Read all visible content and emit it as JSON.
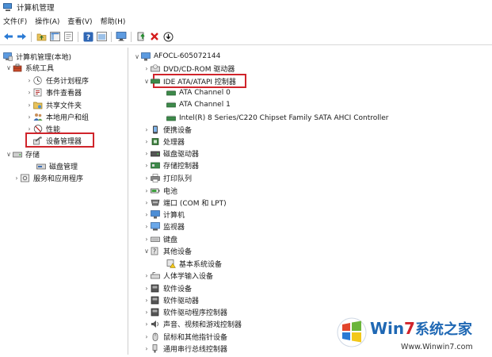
{
  "window": {
    "title": "计算机管理"
  },
  "menu": [
    "文件(F)",
    "操作(A)",
    "查看(V)",
    "帮助(H)"
  ],
  "toolbar_icons": [
    "back-arrow-icon",
    "forward-arrow-icon",
    "up-folder-icon",
    "console-tree-icon",
    "properties-icon",
    "help-icon",
    "pane-icon",
    "monitor-icon",
    "update-driver-icon",
    "uninstall-icon",
    "scan-hardware-icon"
  ],
  "left_tree": {
    "root": "计算机管理(本地)",
    "system_tools": "系统工具",
    "task_scheduler": "任务计划程序",
    "event_viewer": "事件查看器",
    "shared_folders": "共享文件夹",
    "local_users": "本地用户和组",
    "performance": "性能",
    "device_manager": "设备管理器",
    "storage": "存储",
    "disk_management": "磁盘管理",
    "services": "服务和应用程序"
  },
  "device_tree": {
    "computer": "AFOCL-605072144",
    "dvd": "DVD/CD-ROM 驱动器",
    "ide": "IDE ATA/ATAPI 控制器",
    "ch0": "ATA Channel 0",
    "ch1": "ATA Channel 1",
    "sata": "Intel(R) 8 Series/C220 Chipset Family SATA AHCI Controller",
    "portable": "便携设备",
    "cpu": "处理器",
    "disk": "磁盘驱动器",
    "storage_ctrl": "存储控制器",
    "print_queue": "打印队列",
    "battery": "电池",
    "ports": "端口 (COM 和 LPT)",
    "computer_node": "计算机",
    "monitor": "监视器",
    "keyboard": "键盘",
    "other": "其他设备",
    "base_system": "基本系统设备",
    "hid": "人体学输入设备",
    "software_dev": "软件设备",
    "software_drv": "软件驱动器",
    "software_bus": "软件驱动程序控制器",
    "sound": "声音、视频和游戏控制器",
    "mouse": "鼠标和其他指针设备",
    "usb": "通用串行总线控制器"
  },
  "watermark": {
    "brand_a": "Win",
    "brand_b": "7",
    "brand_c": "系统之家",
    "url": "Www.Winwin7.com"
  },
  "colors": {
    "highlight_border": "#d0242b",
    "brand_red": "#d0242b",
    "brand_blue": "#1f68b4"
  }
}
